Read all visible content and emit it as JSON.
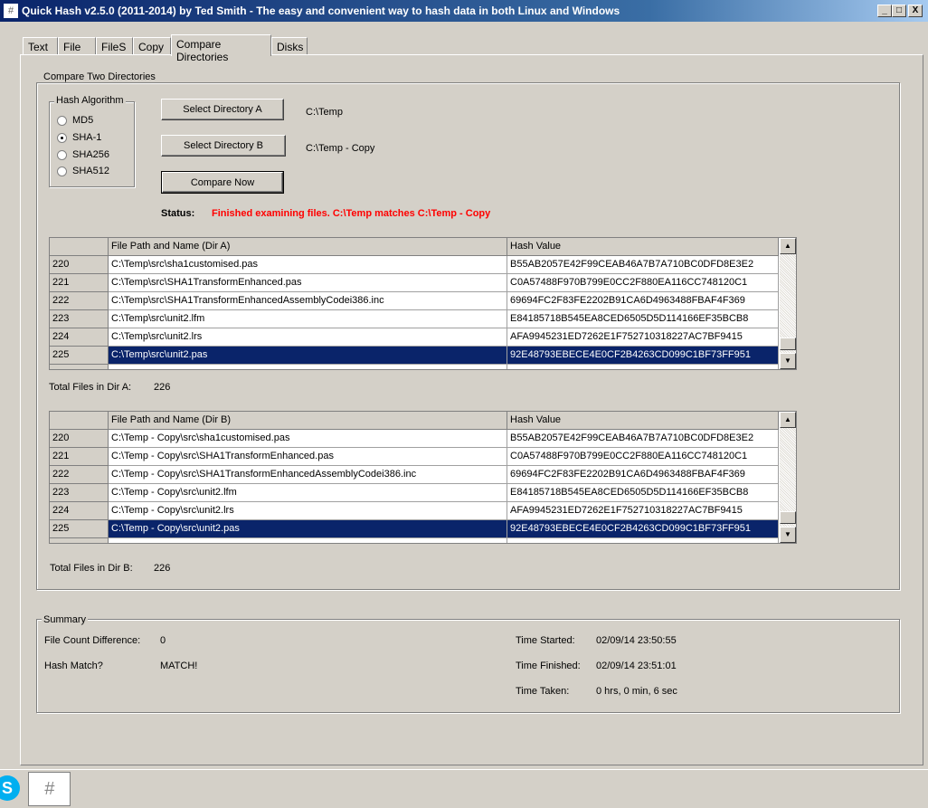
{
  "window": {
    "title": "Quick Hash v2.5.0 (2011-2014) by Ted Smith - The easy and convenient way to hash data in both Linux and Windows",
    "icon": "hash-icon",
    "minimize": "_",
    "maximize": "□",
    "close": "X"
  },
  "tabs": [
    {
      "label": "Text"
    },
    {
      "label": "File"
    },
    {
      "label": "FileS"
    },
    {
      "label": "Copy"
    },
    {
      "label": "Compare Directories",
      "active": true
    },
    {
      "label": "Disks"
    }
  ],
  "compare": {
    "group_label": "Compare Two Directories",
    "algo_label": "Hash Algorithm",
    "algorithms": [
      {
        "label": "MD5",
        "checked": false
      },
      {
        "label": "SHA-1",
        "checked": true
      },
      {
        "label": "SHA256",
        "checked": false
      },
      {
        "label": "SHA512",
        "checked": false
      }
    ],
    "select_a": "Select Directory A",
    "dir_a": "C:\\Temp",
    "select_b": "Select Directory B",
    "dir_b": "C:\\Temp - Copy",
    "compare_now": "Compare Now",
    "status_label": "Status:",
    "status_text": "Finished examining files. C:\\Temp matches C:\\Temp - Copy",
    "status_color": "#ff0000"
  },
  "grid_a": {
    "headers": [
      "",
      "File Path and Name (Dir A)",
      "Hash Value"
    ],
    "rows": [
      [
        "220",
        "C:\\Temp\\src\\sha1customised.pas",
        "B55AB2057E42F99CEAB46A7B7A710BC0DFD8E3E2"
      ],
      [
        "221",
        "C:\\Temp\\src\\SHA1TransformEnhanced.pas",
        "C0A57488F970B799E0CC2F880EA116CC748120C1"
      ],
      [
        "222",
        "C:\\Temp\\src\\SHA1TransformEnhancedAssemblyCodei386.inc",
        "69694FC2F83FE2202B91CA6D4963488FBAF4F369"
      ],
      [
        "223",
        "C:\\Temp\\src\\unit2.lfm",
        "E84185718B545EA8CED6505D5D114166EF35BCB8"
      ],
      [
        "224",
        "C:\\Temp\\src\\unit2.lrs",
        "AFA9945231ED7262E1F752710318227AC7BF9415"
      ],
      [
        "225",
        "C:\\Temp\\src\\unit2.pas",
        "92E48793EBECE4E0CF2B4263CD099C1BF73FF951"
      ]
    ],
    "selected_index": 5,
    "total_label": "Total Files in Dir A:",
    "total": "226"
  },
  "grid_b": {
    "headers": [
      "",
      "File Path and Name (Dir B)",
      "Hash Value"
    ],
    "rows": [
      [
        "220",
        "C:\\Temp - Copy\\src\\sha1customised.pas",
        "B55AB2057E42F99CEAB46A7B7A710BC0DFD8E3E2"
      ],
      [
        "221",
        "C:\\Temp - Copy\\src\\SHA1TransformEnhanced.pas",
        "C0A57488F970B799E0CC2F880EA116CC748120C1"
      ],
      [
        "222",
        "C:\\Temp - Copy\\src\\SHA1TransformEnhancedAssemblyCodei386.inc",
        "69694FC2F83FE2202B91CA6D4963488FBAF4F369"
      ],
      [
        "223",
        "C:\\Temp - Copy\\src\\unit2.lfm",
        "E84185718B545EA8CED6505D5D114166EF35BCB8"
      ],
      [
        "224",
        "C:\\Temp - Copy\\src\\unit2.lrs",
        "AFA9945231ED7262E1F752710318227AC7BF9415"
      ],
      [
        "225",
        "C:\\Temp - Copy\\src\\unit2.pas",
        "92E48793EBECE4E0CF2B4263CD099C1BF73FF951"
      ]
    ],
    "selected_index": 5,
    "total_label": "Total Files in Dir B:",
    "total": "226"
  },
  "summary": {
    "group_label": "Summary",
    "file_count_label": "File Count Difference:",
    "file_count": "0",
    "hash_match_label": "Hash Match?",
    "hash_match": "MATCH!",
    "started_label": "Time Started:",
    "started": "02/09/14 23:50:55",
    "finished_label": "Time Finished:",
    "finished": "02/09/14 23:51:01",
    "taken_label": "Time Taken:",
    "taken": "0 hrs, 0 min, 6 sec"
  },
  "taskbar": {
    "items": [
      {
        "icon": "skype-icon",
        "glyph": "S"
      },
      {
        "icon": "hash-icon",
        "glyph": "#"
      }
    ]
  }
}
